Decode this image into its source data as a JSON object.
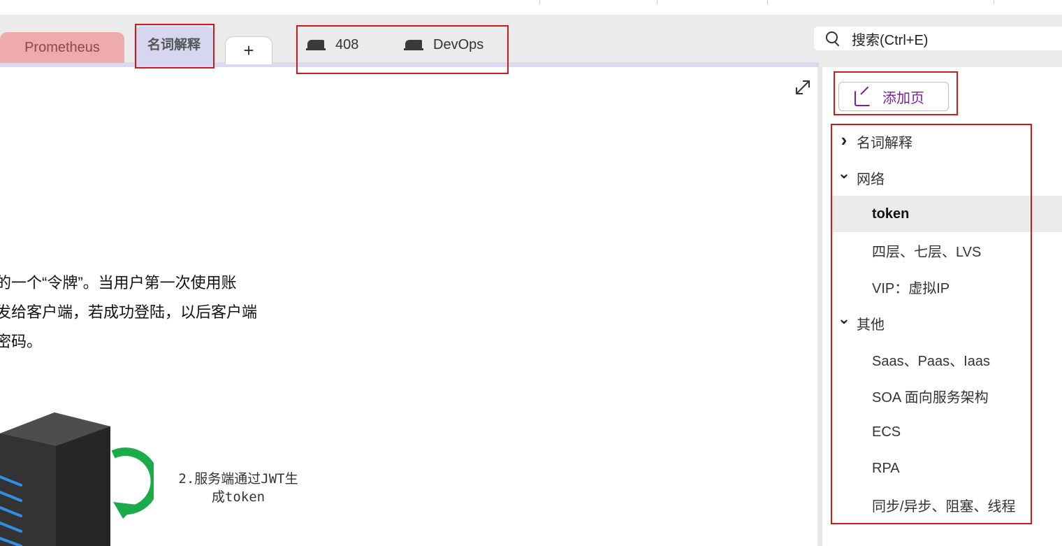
{
  "tabs": {
    "items": [
      {
        "label": "Prometheus"
      },
      {
        "label": "名词解释"
      }
    ],
    "add_label": "+"
  },
  "notebooks": [
    {
      "label": "408"
    },
    {
      "label": "DevOps"
    }
  ],
  "search": {
    "label": "搜索(Ctrl+E)"
  },
  "content": {
    "lines": [
      "的一个“令牌”。当用户第一次使用账",
      "发给客户端，若成功登陆，以后客户端",
      "密码。"
    ],
    "diagram_caption_line1": "2.服务端通过JWT生",
    "diagram_caption_line2": "成token"
  },
  "sidebar": {
    "add_page_label": "添加页",
    "tree": [
      {
        "label": "名词解释",
        "type": "section",
        "expanded": false
      },
      {
        "label": "网络",
        "type": "section",
        "expanded": true
      },
      {
        "label": "token",
        "type": "page",
        "selected": true
      },
      {
        "label": "四层、七层、LVS",
        "type": "page"
      },
      {
        "label": "VIP：虚拟IP",
        "type": "page"
      },
      {
        "label": "其他",
        "type": "section",
        "expanded": true
      },
      {
        "label": "Saas、Paas、Iaas",
        "type": "page"
      },
      {
        "label": "SOA 面向服务架构",
        "type": "page"
      },
      {
        "label": "ECS",
        "type": "page"
      },
      {
        "label": "RPA",
        "type": "page"
      },
      {
        "label": "同步/异步、阻塞、线程",
        "type": "page"
      }
    ]
  },
  "colors": {
    "annotation": "#d11a1a",
    "tab_prometheus": "#eeabab",
    "tab_active": "#d6d6f0",
    "accent": "#7a1fa2",
    "server_light": "#2f8fe0",
    "arrow_green": "#1aab4a"
  }
}
